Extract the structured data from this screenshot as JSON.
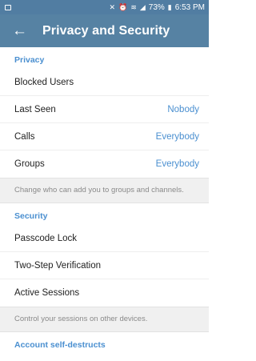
{
  "status_bar": {
    "battery": "73%",
    "time": "6:53 PM"
  },
  "app_bar": {
    "title": "Privacy and Security"
  },
  "privacy": {
    "header": "Privacy",
    "items": [
      {
        "label": "Blocked Users",
        "value": ""
      },
      {
        "label": "Last Seen",
        "value": "Nobody"
      },
      {
        "label": "Calls",
        "value": "Everybody"
      },
      {
        "label": "Groups",
        "value": "Everybody"
      }
    ],
    "info": "Change who can add you to groups and channels."
  },
  "security": {
    "header": "Security",
    "items": [
      {
        "label": "Passcode Lock"
      },
      {
        "label": "Two-Step Verification"
      },
      {
        "label": "Active Sessions"
      }
    ],
    "info": "Control your sessions on other devices."
  },
  "account": {
    "header": "Account self-destructs"
  },
  "colors": {
    "accent": "#4a8fd0",
    "toolbar": "#5682a3",
    "statusbar": "#517da2"
  }
}
